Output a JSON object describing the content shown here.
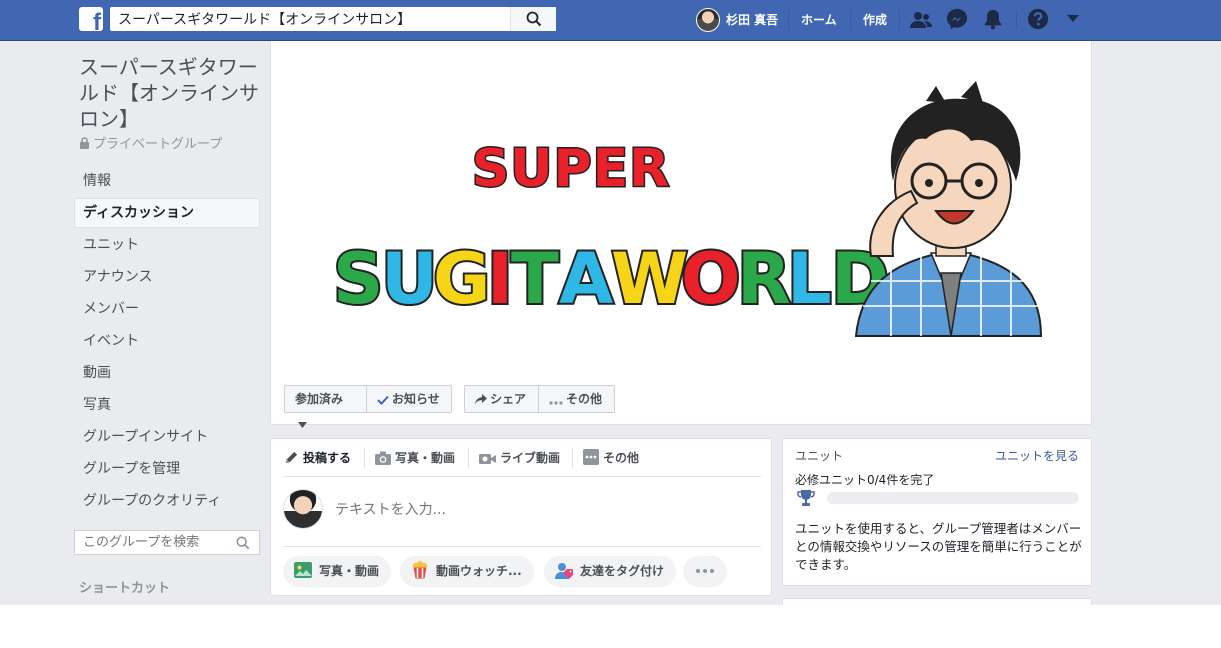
{
  "topbar": {
    "search_value": "スーパースギタワールド【オンラインサロン】",
    "user_name": "杉田 真吾",
    "home_label": "ホーム",
    "create_label": "作成",
    "brand_color": "#4267b2"
  },
  "sidebar": {
    "group_title": "スーパースギタワールド【オンラインサロン】",
    "privacy_label": "プライベートグループ",
    "items": [
      {
        "label": "情報"
      },
      {
        "label": "ディスカッション"
      },
      {
        "label": "ユニット"
      },
      {
        "label": "アナウンス"
      },
      {
        "label": "メンバー"
      },
      {
        "label": "イベント"
      },
      {
        "label": "動画"
      },
      {
        "label": "写真"
      },
      {
        "label": "グループインサイト"
      },
      {
        "label": "グループを管理"
      },
      {
        "label": "グループのクオリティ"
      }
    ],
    "search_placeholder": "このグループを検索",
    "shortcut_heading": "ショートカット"
  },
  "cover": {
    "line1": "SUPER",
    "line2_letters": [
      "S",
      "U",
      "G",
      "I",
      "T",
      "A",
      "W",
      "O",
      "R",
      "L",
      "D"
    ],
    "joined_label": "参加済み",
    "notify_label": "お知らせ",
    "share_label": "シェア",
    "more_label": "その他"
  },
  "composer": {
    "tab_post": "投稿する",
    "tab_photo_video": "写真・動画",
    "tab_live": "ライブ動画",
    "tab_more": "その他",
    "input_placeholder": "テキストを入力...",
    "chip_photo": "写真・動画",
    "chip_watch": "動画ウォッチ...",
    "chip_tag": "友達をタグ付け"
  },
  "units": {
    "title": "ユニット",
    "link": "ユニットを見る",
    "status": "必修ユニット0/4件を完了",
    "completed": 0,
    "total": 4,
    "description": "ユニットを使用すると、グループ管理者はメンバーとの情報交換やリソースの管理を簡単に行うことができます。"
  }
}
